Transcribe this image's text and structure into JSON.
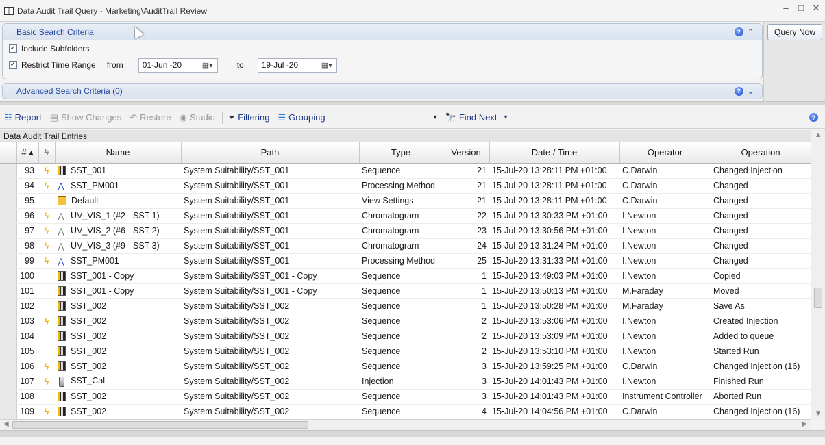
{
  "window": {
    "title": "Data Audit Trail Query - Marketing\\AuditTrail Review",
    "controls": [
      "–",
      "□",
      "✕"
    ]
  },
  "basic_search": {
    "title": "Basic Search Criteria",
    "include_subfolders": {
      "label": "Include Subfolders",
      "checked": true
    },
    "restrict_time_range": {
      "label": "Restrict Time Range",
      "checked": true
    },
    "from_label": "from",
    "from_value": "01-Jun -20",
    "to_label": "to",
    "to_value": "19-Jul -20"
  },
  "advanced_search": {
    "title": "Advanced Search Criteria (0)"
  },
  "query_button": "Query Now",
  "toolbar": {
    "report": "Report",
    "show_changes": "Show Changes",
    "restore": "Restore",
    "studio": "Studio",
    "filtering": "Filtering",
    "grouping": "Grouping",
    "find_next": "Find Next"
  },
  "grid": {
    "caption": "Data Audit Trail Entries",
    "columns": [
      "# ▴",
      "",
      "Name",
      "Path",
      "Type",
      "Version",
      "Date / Time",
      "Operator",
      "Operation"
    ],
    "rows": [
      {
        "num": "93",
        "flag": true,
        "icon": "sequence",
        "name": "SST_001",
        "path": "System Suitability/SST_001",
        "type": "Sequence",
        "version": "21",
        "datetime": "15-Jul-20 13:28:11 PM +01:00",
        "operator": "C.Darwin",
        "operation": "Changed Injection"
      },
      {
        "num": "94",
        "flag": true,
        "icon": "processing",
        "name": "SST_PM001",
        "path": "System Suitability/SST_001",
        "type": "Processing Method",
        "version": "21",
        "datetime": "15-Jul-20 13:28:11 PM +01:00",
        "operator": "C.Darwin",
        "operation": "Changed"
      },
      {
        "num": "95",
        "flag": false,
        "icon": "view",
        "name": "Default",
        "path": "System Suitability/SST_001",
        "type": "View Settings",
        "version": "21",
        "datetime": "15-Jul-20 13:28:11 PM +01:00",
        "operator": "C.Darwin",
        "operation": "Changed"
      },
      {
        "num": "96",
        "flag": true,
        "icon": "chromatogram",
        "name": "UV_VIS_1 (#2 - SST 1)",
        "path": "System Suitability/SST_001",
        "type": "Chromatogram",
        "version": "22",
        "datetime": "15-Jul-20 13:30:33 PM +01:00",
        "operator": "I.Newton",
        "operation": "Changed"
      },
      {
        "num": "97",
        "flag": true,
        "icon": "chromatogram",
        "name": "UV_VIS_2 (#6 - SST 2)",
        "path": "System Suitability/SST_001",
        "type": "Chromatogram",
        "version": "23",
        "datetime": "15-Jul-20 13:30:56 PM +01:00",
        "operator": "I.Newton",
        "operation": "Changed"
      },
      {
        "num": "98",
        "flag": true,
        "icon": "chromatogram",
        "name": "UV_VIS_3 (#9 - SST 3)",
        "path": "System Suitability/SST_001",
        "type": "Chromatogram",
        "version": "24",
        "datetime": "15-Jul-20 13:31:24 PM +01:00",
        "operator": "I.Newton",
        "operation": "Changed"
      },
      {
        "num": "99",
        "flag": true,
        "icon": "processing",
        "name": "SST_PM001",
        "path": "System Suitability/SST_001",
        "type": "Processing Method",
        "version": "25",
        "datetime": "15-Jul-20 13:31:33 PM +01:00",
        "operator": "I.Newton",
        "operation": "Changed"
      },
      {
        "num": "100",
        "flag": false,
        "icon": "sequence",
        "name": "SST_001 - Copy",
        "path": "System Suitability/SST_001 - Copy",
        "type": "Sequence",
        "version": "1",
        "datetime": "15-Jul-20 13:49:03 PM +01:00",
        "operator": "I.Newton",
        "operation": "Copied"
      },
      {
        "num": "101",
        "flag": false,
        "icon": "sequence",
        "name": "SST_001 - Copy",
        "path": "System Suitability/SST_001 - Copy",
        "type": "Sequence",
        "version": "1",
        "datetime": "15-Jul-20 13:50:13 PM +01:00",
        "operator": "M.Faraday",
        "operation": "Moved"
      },
      {
        "num": "102",
        "flag": false,
        "icon": "sequence",
        "name": "SST_002",
        "path": "System Suitability/SST_002",
        "type": "Sequence",
        "version": "1",
        "datetime": "15-Jul-20 13:50:28 PM +01:00",
        "operator": "M.Faraday",
        "operation": "Save As"
      },
      {
        "num": "103",
        "flag": true,
        "icon": "sequence",
        "name": "SST_002",
        "path": "System Suitability/SST_002",
        "type": "Sequence",
        "version": "2",
        "datetime": "15-Jul-20 13:53:06 PM +01:00",
        "operator": "I.Newton",
        "operation": "Created Injection"
      },
      {
        "num": "104",
        "flag": false,
        "icon": "sequence",
        "name": "SST_002",
        "path": "System Suitability/SST_002",
        "type": "Sequence",
        "version": "2",
        "datetime": "15-Jul-20 13:53:09 PM +01:00",
        "operator": "I.Newton",
        "operation": "Added to queue"
      },
      {
        "num": "105",
        "flag": false,
        "icon": "sequence",
        "name": "SST_002",
        "path": "System Suitability/SST_002",
        "type": "Sequence",
        "version": "2",
        "datetime": "15-Jul-20 13:53:10 PM +01:00",
        "operator": "I.Newton",
        "operation": "Started Run"
      },
      {
        "num": "106",
        "flag": true,
        "icon": "sequence",
        "name": "SST_002",
        "path": "System Suitability/SST_002",
        "type": "Sequence",
        "version": "3",
        "datetime": "15-Jul-20 13:59:25 PM +01:00",
        "operator": "C.Darwin",
        "operation": "Changed Injection (16)"
      },
      {
        "num": "107",
        "flag": true,
        "icon": "injection",
        "name": "SST_Cal",
        "path": "System Suitability/SST_002",
        "type": "Injection",
        "version": "3",
        "datetime": "15-Jul-20 14:01:43 PM +01:00",
        "operator": "I.Newton",
        "operation": "Finished Run"
      },
      {
        "num": "108",
        "flag": false,
        "icon": "sequence",
        "name": "SST_002",
        "path": "System Suitability/SST_002",
        "type": "Sequence",
        "version": "3",
        "datetime": "15-Jul-20 14:01:43 PM +01:00",
        "operator": "Instrument Controller",
        "operation": "Aborted Run"
      },
      {
        "num": "109",
        "flag": true,
        "icon": "sequence",
        "name": "SST_002",
        "path": "System Suitability/SST_002",
        "type": "Sequence",
        "version": "4",
        "datetime": "15-Jul-20 14:04:56 PM +01:00",
        "operator": "C.Darwin",
        "operation": "Changed Injection (16)"
      }
    ]
  }
}
